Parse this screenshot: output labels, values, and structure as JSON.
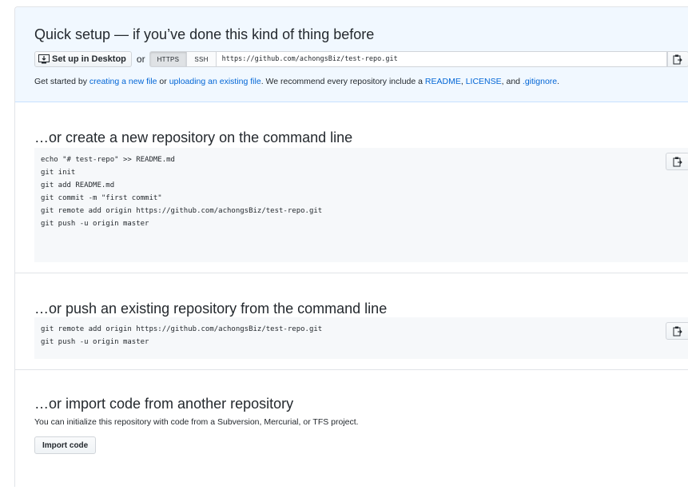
{
  "quick_setup": {
    "title": "Quick setup — if you’ve done this kind of thing before",
    "desktop_button": "Set up in Desktop",
    "or": "or",
    "https_label": "HTTPS",
    "ssh_label": "SSH",
    "clone_url": "https://github.com/achongsBiz/test-repo.git",
    "getting_started": {
      "prefix": "Get started by ",
      "link_new_file": "creating a new file",
      "middle1": " or ",
      "link_upload": "uploading an existing file",
      "middle2": ". We recommend every repository include a ",
      "link_readme": "README",
      "sep1": ", ",
      "link_license": "LICENSE",
      "sep2": ", and ",
      "link_gitignore": ".gitignore",
      "suffix": "."
    }
  },
  "create_new": {
    "title": "…or create a new repository on the command line",
    "lines": [
      "echo \"# test-repo\" >> README.md",
      "git init",
      "git add README.md",
      "git commit -m \"first commit\"",
      "git remote add origin https://github.com/achongsBiz/test-repo.git",
      "git push -u origin master"
    ]
  },
  "push_existing": {
    "title": "…or push an existing repository from the command line",
    "lines": [
      "git remote add origin https://github.com/achongsBiz/test-repo.git",
      "git push -u origin master"
    ]
  },
  "import": {
    "title": "…or import code from another repository",
    "description": "You can initialize this repository with code from a Subversion, Mercurial, or TFS project.",
    "button": "Import code"
  },
  "icons": {
    "desktop": "desktop-download-icon",
    "clipboard": "clipboard-icon"
  }
}
